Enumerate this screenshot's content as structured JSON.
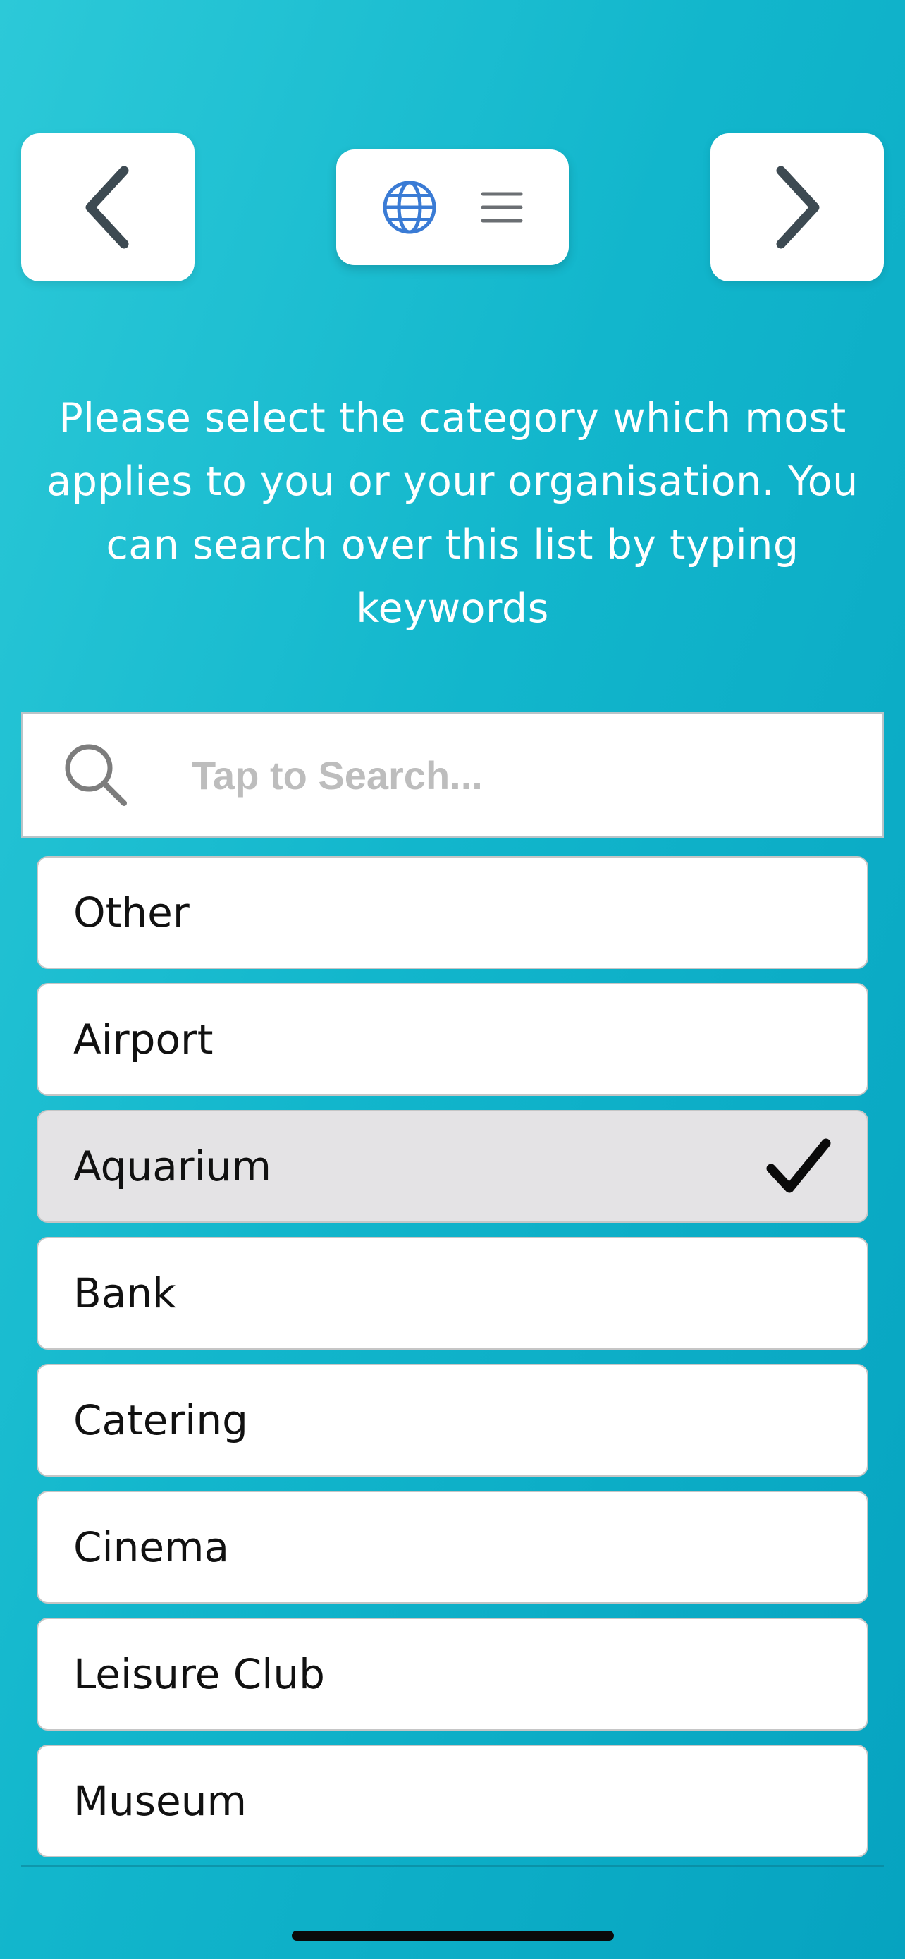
{
  "header": {
    "back_icon": "chevron-left-icon",
    "forward_icon": "chevron-right-icon",
    "language_icon": "globe-icon",
    "menu_icon": "hamburger-menu-icon",
    "icon_color": "#3d4a52",
    "globe_color": "#3a7bd5"
  },
  "instructions": {
    "text": "Please select the category which most applies to you or your organisation. You can search over this list by typing keywords"
  },
  "search": {
    "placeholder": "Tap to Search...",
    "value": ""
  },
  "categories": {
    "items": [
      {
        "label": "Other",
        "selected": false
      },
      {
        "label": "Airport",
        "selected": false
      },
      {
        "label": "Aquarium",
        "selected": true
      },
      {
        "label": "Bank",
        "selected": false
      },
      {
        "label": "Catering",
        "selected": false
      },
      {
        "label": "Cinema",
        "selected": false
      },
      {
        "label": "Leisure Club",
        "selected": false
      },
      {
        "label": "Museum",
        "selected": false
      }
    ]
  },
  "colors": {
    "background_gradient_start": "#2cc9d8",
    "background_gradient_end": "#06a3c0",
    "selected_row": "#e4e3e5"
  }
}
